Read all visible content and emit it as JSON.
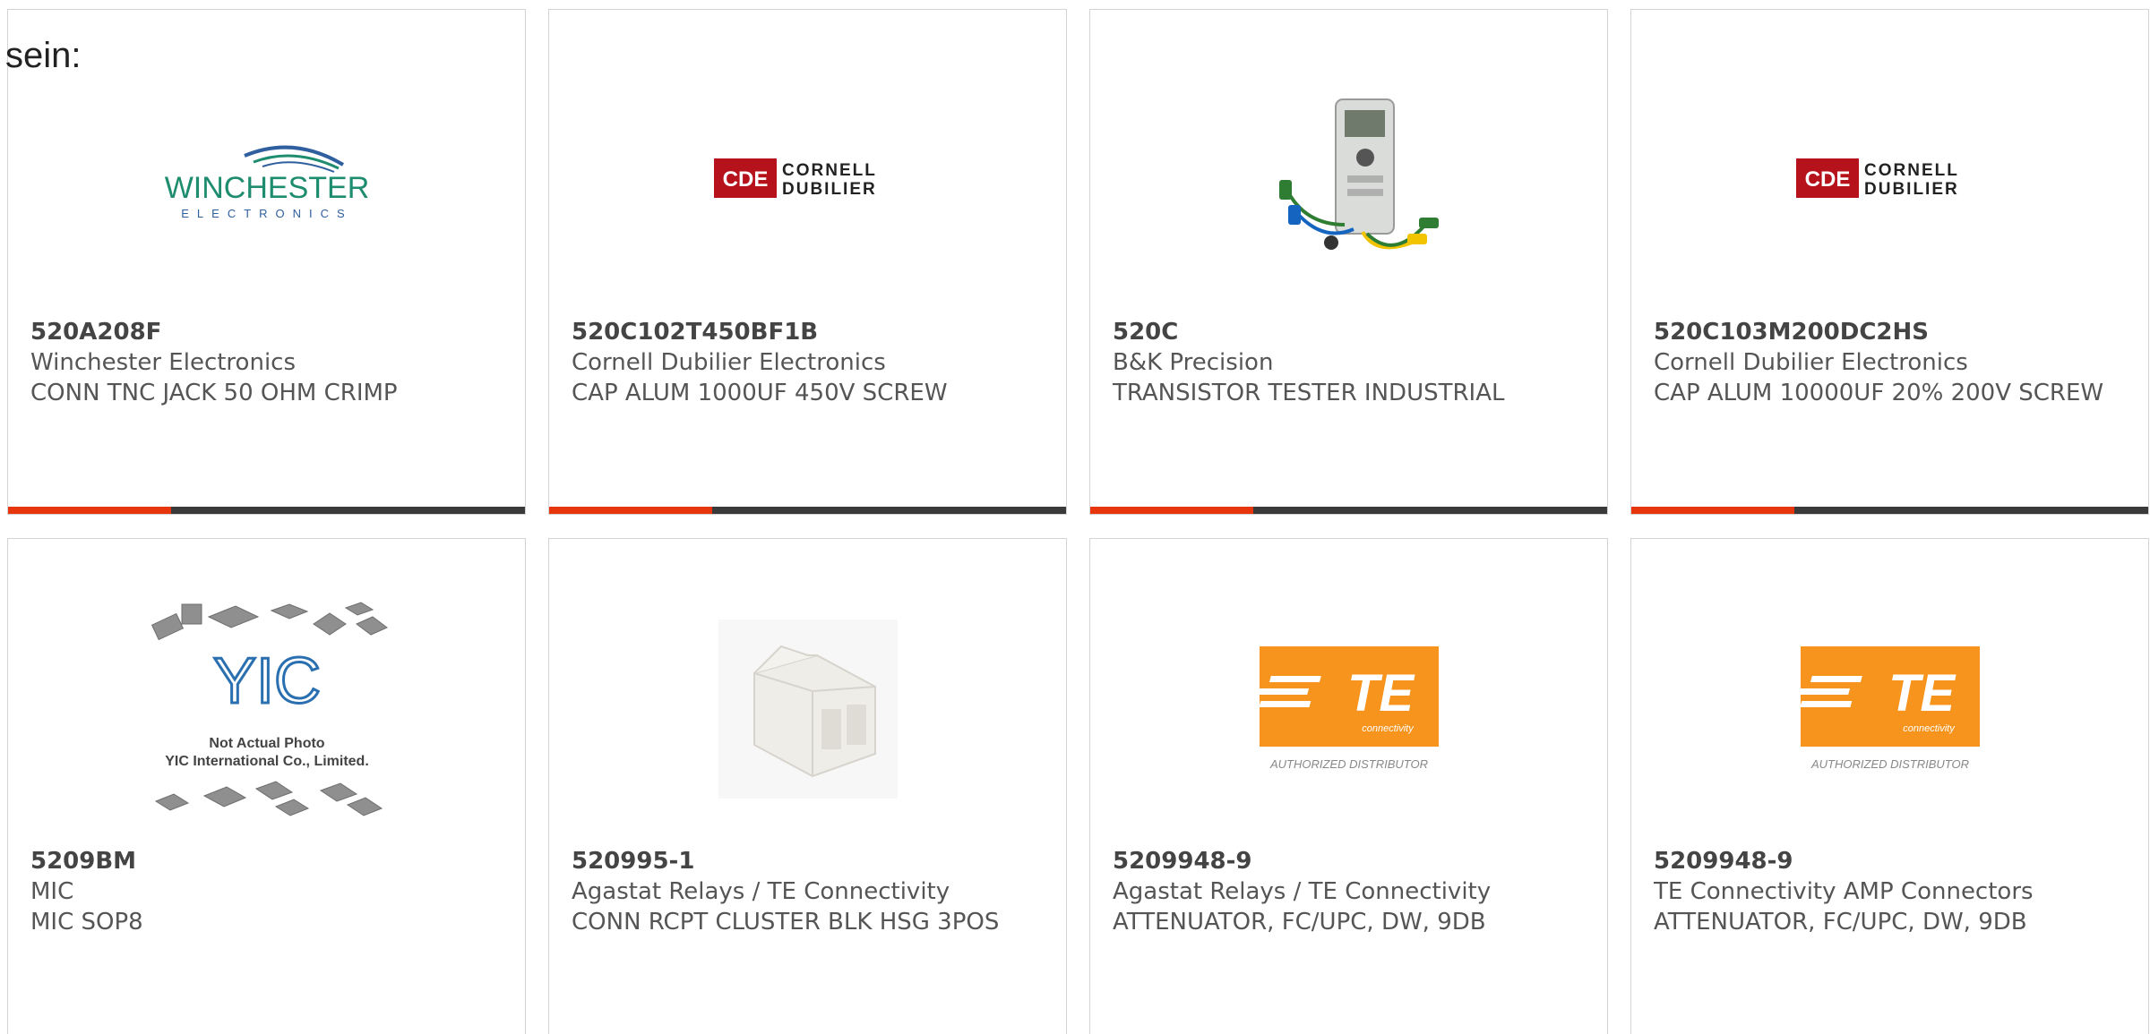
{
  "lead_text": "sein:",
  "products": [
    {
      "part_number": "520A208F",
      "manufacturer": "Winchester Electronics",
      "description": "CONN TNC JACK 50 OHM CRIMP",
      "logo": {
        "main": "WINCHESTER",
        "sub": "ELECTRONICS"
      }
    },
    {
      "part_number": "520C102T450BF1B",
      "manufacturer": "Cornell Dubilier Electronics",
      "description": "CAP ALUM 1000UF 450V SCREW",
      "logo": {
        "badge": "CDE",
        "line1": "CORNELL",
        "line2": "DUBILIER"
      }
    },
    {
      "part_number": "520C",
      "manufacturer": "B&K Precision",
      "description": "TRANSISTOR TESTER INDUSTRIAL"
    },
    {
      "part_number": "520C103M200DC2HS",
      "manufacturer": "Cornell Dubilier Electronics",
      "description": "CAP ALUM 10000UF 20% 200V SCREW",
      "logo": {
        "badge": "CDE",
        "line1": "CORNELL",
        "line2": "DUBILIER"
      }
    },
    {
      "part_number": "5209BM",
      "manufacturer": "MIC",
      "description": "MIC SOP8",
      "logo": {
        "line1": "Not Actual Photo",
        "line2": "YIC International Co., Limited."
      }
    },
    {
      "part_number": "520995-1",
      "manufacturer": "Agastat Relays / TE Connectivity",
      "description": "CONN RCPT CLUSTER BLK HSG 3POS"
    },
    {
      "part_number": "5209948-9",
      "manufacturer": "Agastat Relays / TE Connectivity",
      "description": "ATTENUATOR, FC/UPC, DW, 9DB",
      "logo": {
        "mark": "TE",
        "sub": "connectivity",
        "caption": "AUTHORIZED DISTRIBUTOR"
      }
    },
    {
      "part_number": "5209948-9",
      "manufacturer": "TE Connectivity AMP Connectors",
      "description": "ATTENUATOR, FC/UPC, DW, 9DB",
      "logo": {
        "mark": "TE",
        "sub": "connectivity",
        "caption": "AUTHORIZED DISTRIBUTOR"
      }
    }
  ],
  "colors": {
    "accent": "#e8360c",
    "underline": "#3a3a3a",
    "te_orange": "#f7941d",
    "cde_red": "#b5121b",
    "winchester_green": "#1e8c6e",
    "yic_blue": "#2a6fb0"
  }
}
